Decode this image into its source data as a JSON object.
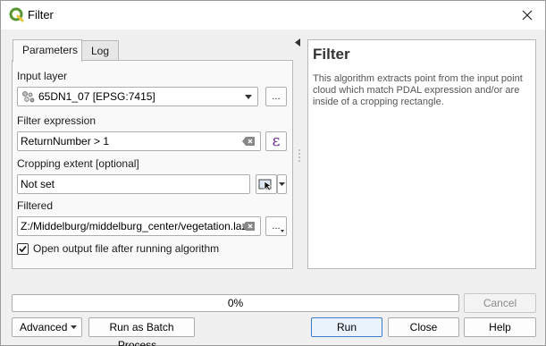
{
  "window": {
    "title": "Filter"
  },
  "tabs": [
    {
      "label": "Parameters"
    },
    {
      "label": "Log"
    }
  ],
  "params": {
    "input_layer": {
      "label": "Input layer",
      "value": "65DN1_07 [EPSG:7415]",
      "browse": "..."
    },
    "filter_expression": {
      "label": "Filter expression",
      "value": "ReturnNumber > 1",
      "expr_icon": "ε"
    },
    "cropping_extent": {
      "label": "Cropping extent [optional]",
      "value": "Not set"
    },
    "filtered": {
      "label": "Filtered",
      "value": "Z:/Middelburg/middelburg_center/vegetation.laz",
      "browse": "..."
    },
    "open_output": {
      "label": "Open output file after running algorithm",
      "checked": true
    }
  },
  "help": {
    "title": "Filter",
    "body": "This algorithm extracts point from the input point cloud which match PDAL expression and/or are inside of a cropping rectangle."
  },
  "progress": {
    "text": "0%",
    "value": 0
  },
  "buttons": {
    "cancel": "Cancel",
    "advanced": "Advanced",
    "batch": "Run as Batch Process...",
    "run": "Run",
    "close": "Close",
    "help": "Help"
  },
  "icons": {
    "app": "qgis-icon",
    "layer": "point-cloud-layer-icon",
    "extent": "map-canvas-select-icon"
  },
  "colors": {
    "qgis_green": "#589632",
    "accent_blue": "#3d7dd1",
    "expr_purple": "#6a2c8e"
  }
}
